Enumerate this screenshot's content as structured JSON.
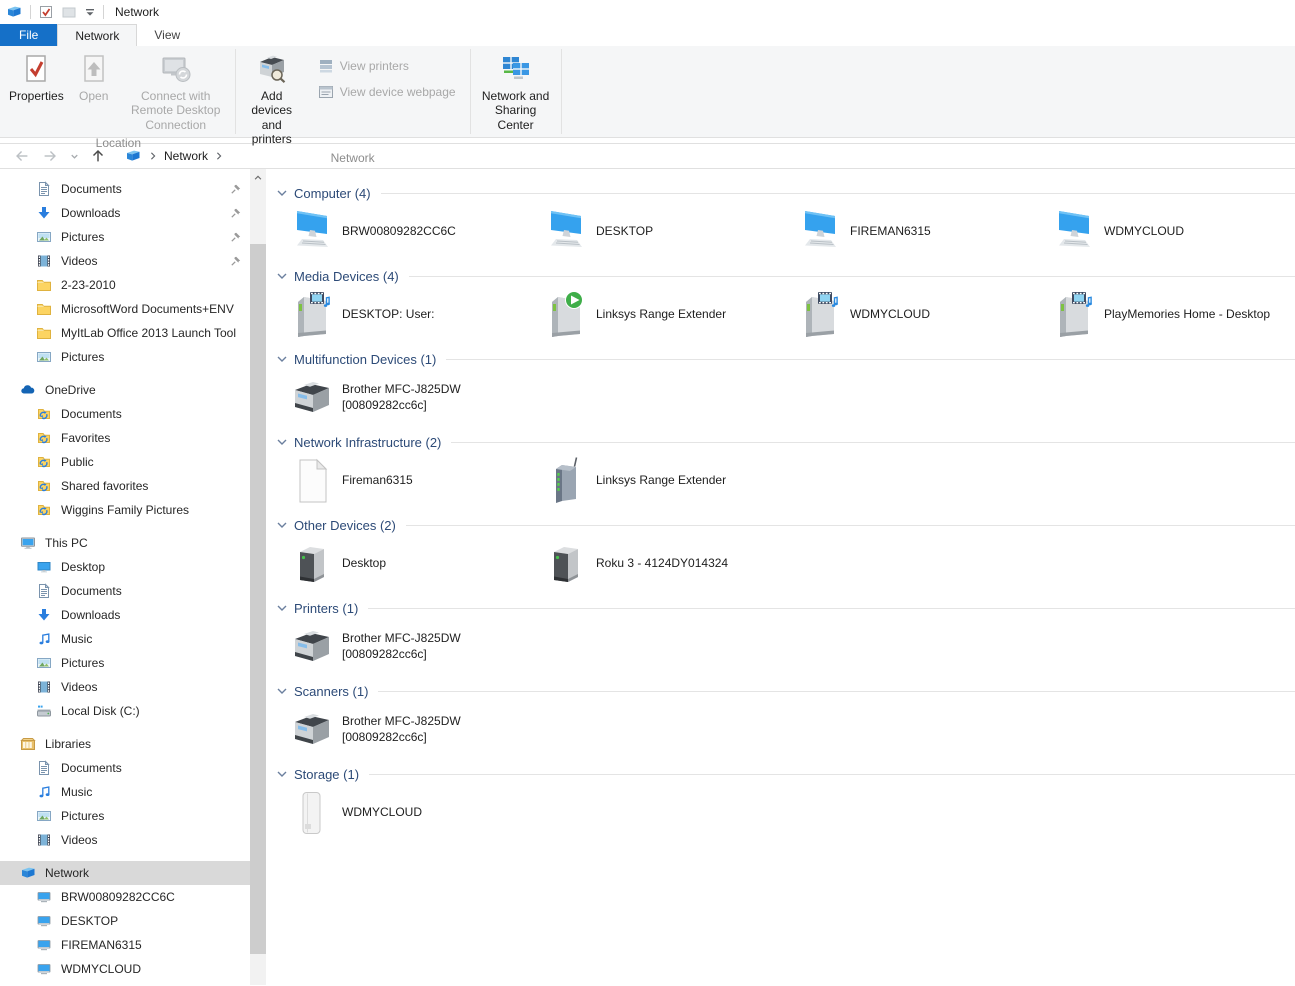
{
  "colors": {
    "accent_file_tab": "#1570c8",
    "section_header_text": "#2c4a77",
    "selected_row_bg": "#d9d9d9",
    "ribbon_bg": "#f5f6f7",
    "disabled_text": "#a8a8a8"
  },
  "titlebar": {
    "title": "Network",
    "quick_access_icons": [
      "network-window-icon",
      "qat-properties-icon",
      "qat-new-folder-icon",
      "qat-customize-chevron-icon"
    ]
  },
  "tabs": [
    {
      "label": "File",
      "active": false
    },
    {
      "label": "Network",
      "active": true
    },
    {
      "label": "View",
      "active": false
    }
  ],
  "ribbon": {
    "groups": [
      {
        "label": "Location",
        "buttons": [
          {
            "label": "Properties",
            "icon": "properties-icon",
            "enabled": true
          },
          {
            "label": "Open",
            "icon": "open-icon",
            "enabled": false
          },
          {
            "label": "Connect with Remote Desktop Connection",
            "icon": "remote-desktop-icon",
            "enabled": false
          }
        ]
      },
      {
        "label": "Network",
        "buttons": [
          {
            "label": "Add devices and printers",
            "icon": "add-devices-icon",
            "enabled": true
          },
          {
            "label": "View printers",
            "icon": "view-printers-icon",
            "enabled": false
          },
          {
            "label": "View device webpage",
            "icon": "view-device-webpage-icon",
            "enabled": false
          }
        ]
      },
      {
        "label": "",
        "buttons": [
          {
            "label": "Network and Sharing Center",
            "icon": "network-sharing-icon",
            "enabled": true
          }
        ]
      }
    ]
  },
  "addressbar": {
    "nav": [
      "back",
      "forward",
      "recent-locations",
      "up"
    ],
    "breadcrumb_icon": "network-node-icon",
    "breadcrumb": [
      "Network"
    ]
  },
  "sidebar": {
    "items": [
      {
        "label": "Documents",
        "icon": "document-icon",
        "level": 1,
        "pinned": true
      },
      {
        "label": "Downloads",
        "icon": "download-icon",
        "level": 1,
        "pinned": true
      },
      {
        "label": "Pictures",
        "icon": "pictures-icon",
        "level": 1,
        "pinned": true
      },
      {
        "label": "Videos",
        "icon": "videos-icon",
        "level": 1,
        "pinned": true
      },
      {
        "label": "2-23-2010",
        "icon": "folder-icon",
        "level": 1
      },
      {
        "label": "MicrosoftWord Documents+ENV",
        "icon": "folder-icon",
        "level": 1
      },
      {
        "label": "MyItLab Office 2013 Launch Tool",
        "icon": "folder-icon",
        "level": 1
      },
      {
        "label": "Pictures",
        "icon": "pictures-icon",
        "level": 1
      },
      {
        "label": "OneDrive",
        "icon": "onedrive-icon",
        "level": 0,
        "gap": true
      },
      {
        "label": "Documents",
        "icon": "sync-folder-icon",
        "level": 1
      },
      {
        "label": "Favorites",
        "icon": "sync-folder-icon",
        "level": 1
      },
      {
        "label": "Public",
        "icon": "sync-folder-icon",
        "level": 1
      },
      {
        "label": "Shared favorites",
        "icon": "sync-folder-icon",
        "level": 1
      },
      {
        "label": "Wiggins Family Pictures",
        "icon": "sync-folder-icon",
        "level": 1
      },
      {
        "label": "This PC",
        "icon": "thispc-icon",
        "level": 0,
        "gap": true
      },
      {
        "label": "Desktop",
        "icon": "desktop-icon",
        "level": 1
      },
      {
        "label": "Documents",
        "icon": "document-icon",
        "level": 1
      },
      {
        "label": "Downloads",
        "icon": "download-icon",
        "level": 1
      },
      {
        "label": "Music",
        "icon": "music-icon",
        "level": 1
      },
      {
        "label": "Pictures",
        "icon": "pictures-icon",
        "level": 1
      },
      {
        "label": "Videos",
        "icon": "videos-icon",
        "level": 1
      },
      {
        "label": "Local Disk (C:)",
        "icon": "drive-icon",
        "level": 1
      },
      {
        "label": "Libraries",
        "icon": "libraries-icon",
        "level": 0,
        "gap": true
      },
      {
        "label": "Documents",
        "icon": "document-icon",
        "level": 1
      },
      {
        "label": "Music",
        "icon": "music-icon",
        "level": 1
      },
      {
        "label": "Pictures",
        "icon": "pictures-icon",
        "level": 1
      },
      {
        "label": "Videos",
        "icon": "videos-icon",
        "level": 1
      },
      {
        "label": "Network",
        "icon": "network-node-icon",
        "level": 0,
        "gap": true,
        "selected": true
      },
      {
        "label": "BRW00809282CC6C",
        "icon": "network-pc-icon",
        "level": 1
      },
      {
        "label": "DESKTOP",
        "icon": "network-pc-icon",
        "level": 1
      },
      {
        "label": "FIREMAN6315",
        "icon": "network-pc-icon",
        "level": 1
      },
      {
        "label": "WDMYCLOUD",
        "icon": "network-pc-icon",
        "level": 1
      }
    ]
  },
  "main": {
    "sections": [
      {
        "title": "Computer (4)",
        "items": [
          {
            "label": "BRW00809282CC6C",
            "icon": "computer-icon"
          },
          {
            "label": "DESKTOP",
            "icon": "computer-icon"
          },
          {
            "label": "FIREMAN6315",
            "icon": "computer-icon"
          },
          {
            "label": "WDMYCLOUD",
            "icon": "computer-icon"
          }
        ]
      },
      {
        "title": "Media Devices (4)",
        "items": [
          {
            "label": "DESKTOP: User:",
            "icon": "media-device-film-icon"
          },
          {
            "label": "Linksys Range Extender",
            "icon": "media-device-play-icon"
          },
          {
            "label": "WDMYCLOUD",
            "icon": "media-device-film-icon"
          },
          {
            "label": "PlayMemories Home - Desktop",
            "icon": "media-device-film-icon"
          }
        ]
      },
      {
        "title": "Multifunction Devices (1)",
        "items": [
          {
            "label": "Brother MFC-J825DW",
            "sublabel": "[00809282cc6c]",
            "icon": "printer-icon"
          }
        ]
      },
      {
        "title": "Network Infrastructure (2)",
        "items": [
          {
            "label": "Fireman6315",
            "icon": "page-icon"
          },
          {
            "label": "Linksys Range Extender",
            "icon": "router-icon"
          }
        ]
      },
      {
        "title": "Other Devices (2)",
        "items": [
          {
            "label": "Desktop",
            "icon": "device-box-icon"
          },
          {
            "label": "Roku 3 - 4124DY014324",
            "icon": "device-box-icon"
          }
        ]
      },
      {
        "title": "Printers (1)",
        "items": [
          {
            "label": "Brother MFC-J825DW",
            "sublabel": "[00809282cc6c]",
            "icon": "printer-icon"
          }
        ]
      },
      {
        "title": "Scanners (1)",
        "items": [
          {
            "label": "Brother MFC-J825DW",
            "sublabel": "[00809282cc6c]",
            "icon": "printer-icon"
          }
        ]
      },
      {
        "title": "Storage (1)",
        "items": [
          {
            "label": "WDMYCLOUD",
            "icon": "nas-icon"
          }
        ]
      }
    ]
  }
}
